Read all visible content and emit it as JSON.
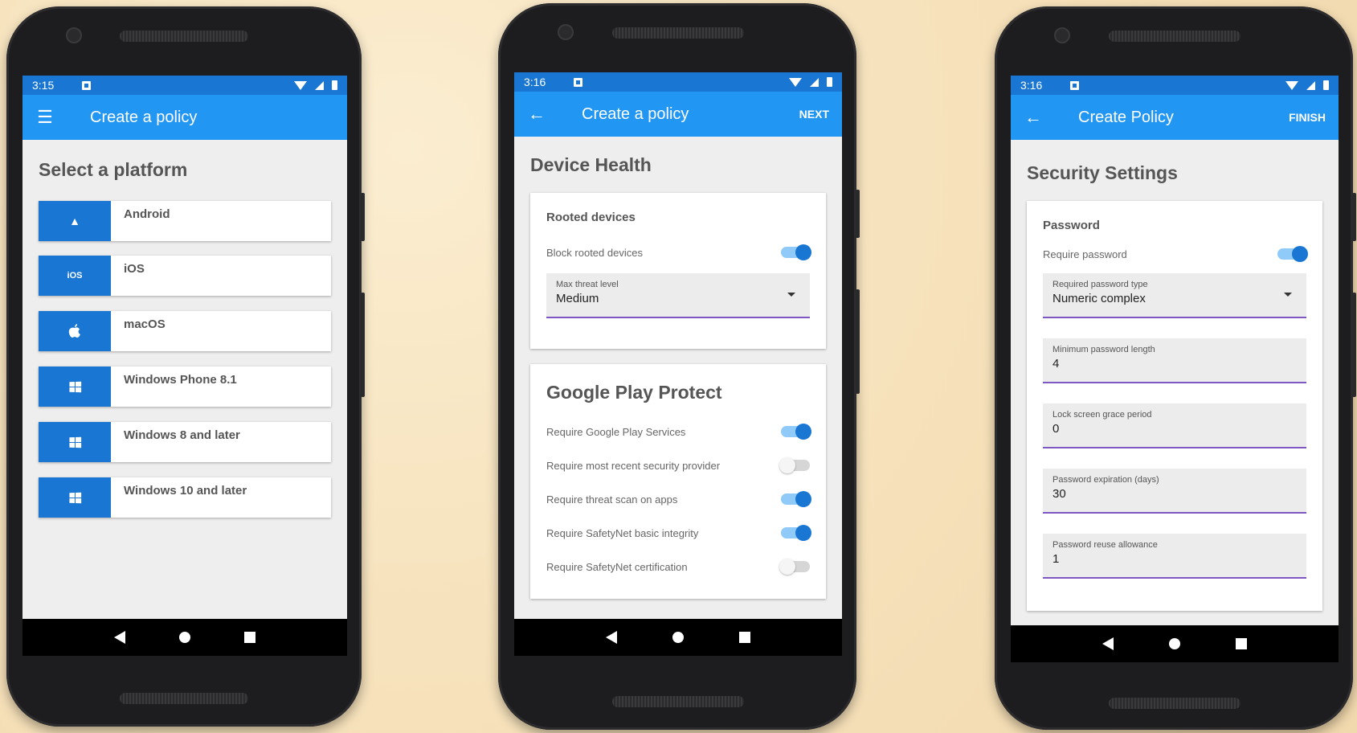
{
  "phone1": {
    "status_time": "3:15",
    "title": "Create a policy",
    "heading": "Select a platform",
    "platforms": [
      {
        "label": "Android",
        "icon": "android-icon",
        "icon_text": "▲"
      },
      {
        "label": "iOS",
        "icon": "ios-icon",
        "icon_text": "iOS"
      },
      {
        "label": "macOS",
        "icon": "apple-icon",
        "icon_text": ""
      },
      {
        "label": "Windows Phone 8.1",
        "icon": "windows-icon"
      },
      {
        "label": "Windows 8 and later",
        "icon": "windows-icon"
      },
      {
        "label": "Windows 10 and later",
        "icon": "windows-icon"
      }
    ]
  },
  "phone2": {
    "status_time": "3:16",
    "title": "Create a policy",
    "action": "NEXT",
    "heading": "Device Health",
    "rooted_title": "Rooted devices",
    "block_rooted": {
      "label": "Block rooted devices",
      "on": true
    },
    "threat_level": {
      "label": "Max threat level",
      "value": "Medium"
    },
    "gpp_title": "Google Play Protect",
    "gpp_rows": [
      {
        "label": "Require Google Play Services",
        "on": true
      },
      {
        "label": "Require most recent security provider",
        "on": false
      },
      {
        "label": "Require threat scan on apps",
        "on": true
      },
      {
        "label": "Require SafetyNet basic integrity",
        "on": true
      },
      {
        "label": "Require SafetyNet certification",
        "on": false
      }
    ]
  },
  "phone3": {
    "status_time": "3:16",
    "title": "Create Policy",
    "action": "FINISH",
    "heading": "Security Settings",
    "password_title": "Password",
    "require_password": {
      "label": "Require password",
      "on": true
    },
    "fields": [
      {
        "label": "Required password type",
        "value": "Numeric complex",
        "dropdown": true
      },
      {
        "label": "Minimum password length",
        "value": "4"
      },
      {
        "label": "Lock screen grace period",
        "value": "0"
      },
      {
        "label": "Password expiration (days)",
        "value": "30"
      },
      {
        "label": "Password reuse allowance",
        "value": "1"
      }
    ]
  },
  "colors": {
    "appbar": "#2196f3",
    "statusbar": "#1976d2",
    "accent": "#1976d2",
    "underline": "#7e57c2"
  }
}
